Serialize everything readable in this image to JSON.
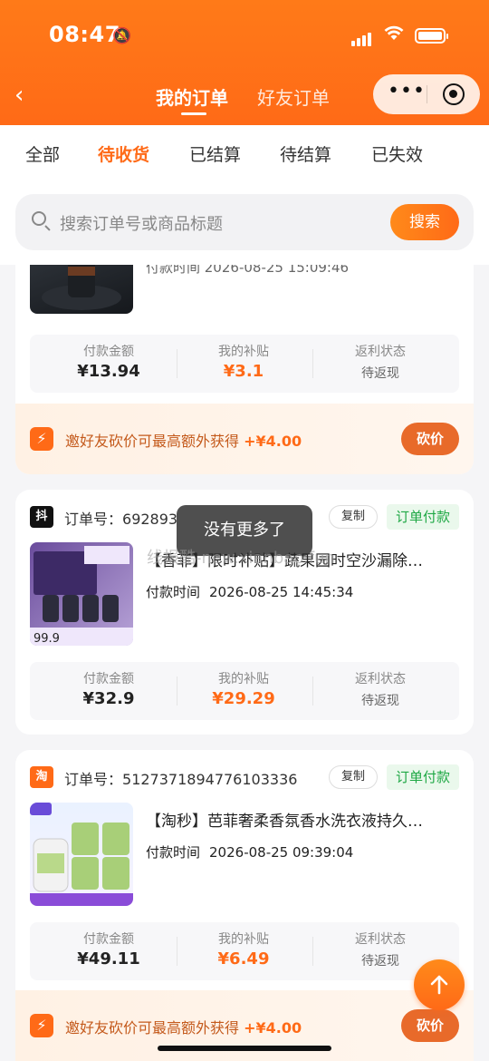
{
  "status_bar": {
    "time": "08:47"
  },
  "nav": {
    "back": "‹",
    "tab_my_orders": "我的订单",
    "tab_friend_orders": "好友订单"
  },
  "filters": [
    "全部",
    "待收货",
    "已结算",
    "待结算",
    "已失效"
  ],
  "active_filter_index": 1,
  "search": {
    "placeholder": "搜索订单号或商品标题",
    "button": "搜索"
  },
  "labels": {
    "pay_amount": "付款金额",
    "my_subsidy": "我的补贴",
    "rebate_status": "返利状态",
    "pay_time": "付款时间",
    "order_no": "订单号：",
    "copy": "复制",
    "bargain": "砍价"
  },
  "promo_text": "邀好友砍价可最高额外获得",
  "promo_amount": "+¥4.00",
  "orders": [
    {
      "pay_time_partial": "付款时间 2026-08-25 15:09:46",
      "amount": "¥13.94",
      "subsidy": "¥3.1",
      "rebate": "待返现"
    },
    {
      "source": "抖",
      "source_color": "#111111",
      "order_no": "692893",
      "order_status": "订单付款",
      "title": "【香菲】限时补贴】蔬果园时空沙漏除…",
      "pay_time": "2026-08-25 14:45:34",
      "amount": "¥32.9",
      "subsidy": "¥29.29",
      "rebate": "待返现"
    },
    {
      "source": "淘",
      "source_color": "#ff6a17",
      "order_no": "5127371894776103336",
      "order_status": "订单付款",
      "title": "【淘秒】芭菲奢柔香氛香水洗衣液持久…",
      "pay_time": "2026-08-25 09:39:04",
      "amount": "¥49.11",
      "subsidy": "¥6.49",
      "rebate": "待返现"
    }
  ],
  "toast": "没有更多了",
  "watermark": "线报酷-new.xianbao.fun",
  "colors": {
    "accent": "#ff6a17",
    "success": "#1fa845"
  }
}
